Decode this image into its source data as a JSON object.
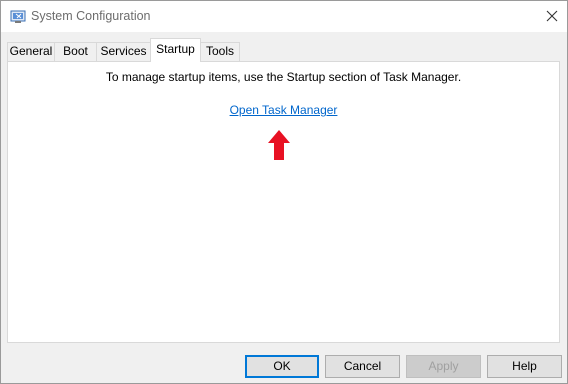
{
  "window": {
    "title": "System Configuration"
  },
  "tabs": [
    {
      "label": "General"
    },
    {
      "label": "Boot"
    },
    {
      "label": "Services"
    },
    {
      "label": "Startup"
    },
    {
      "label": "Tools"
    }
  ],
  "active_tab": "Startup",
  "startup": {
    "info_text": "To manage startup items, use the Startup section of Task Manager.",
    "link_label": "Open Task Manager"
  },
  "buttons": {
    "ok": "OK",
    "cancel": "Cancel",
    "apply": "Apply",
    "help": "Help"
  },
  "colors": {
    "link": "#0066cc",
    "arrow": "#e81123",
    "default_button_border": "#0078d7"
  },
  "icons": {
    "app": "system-configuration-icon",
    "close": "close-icon",
    "arrow": "red-up-arrow-icon"
  }
}
